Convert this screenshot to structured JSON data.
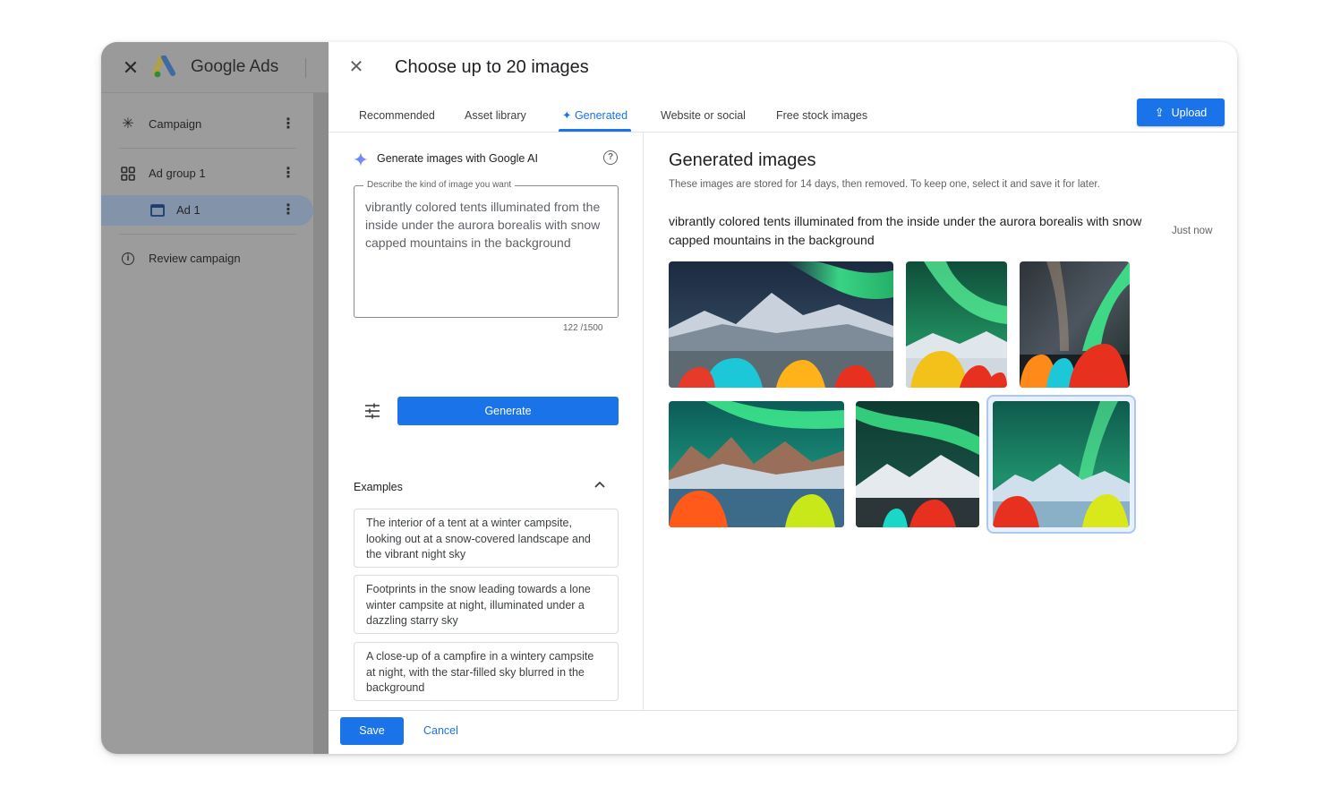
{
  "sidebar": {
    "brand": "Google Ads",
    "items": [
      {
        "label": "Campaign",
        "icon": "asterisk-icon"
      },
      {
        "label": "Ad group 1",
        "icon": "grid-icon"
      },
      {
        "label": "Ad 1",
        "icon": "ad-icon"
      },
      {
        "label": "Review campaign",
        "icon": "info-icon"
      }
    ]
  },
  "dialog": {
    "title": "Choose up to 20 images",
    "tabs": [
      {
        "label": "Recommended"
      },
      {
        "label": "Asset library"
      },
      {
        "label": "✦ Generated",
        "active": true
      },
      {
        "label": "Website or social"
      },
      {
        "label": "Free stock images"
      }
    ],
    "upload_label": "Upload"
  },
  "generator": {
    "heading": "Generate images with Google AI",
    "prompt_label": "Describe the kind of image you want",
    "prompt_value": "vibrantly colored tents illuminated from the inside under the aurora borealis with snow capped mountains in the background",
    "char_count": "122 /1500",
    "generate_label": "Generate",
    "examples_heading": "Examples",
    "examples": [
      "The interior of a tent at a winter campsite, looking out at a snow-covered landscape and the vibrant night sky",
      "Footprints in the snow leading towards a lone winter campsite at night, illuminated under a dazzling starry sky",
      "A close-up of a campfire in a wintery campsite at night, with the star-filled sky blurred in the background"
    ]
  },
  "results": {
    "title": "Generated images",
    "subtitle": "These images are stored for 14 days, then removed. To keep one, select it and save it for later.",
    "prompt": "vibrantly colored tents illuminated from the inside under the aurora borealis with snow capped mountains in the background",
    "time": "Just now"
  },
  "footer": {
    "save_label": "Save",
    "cancel_label": "Cancel"
  },
  "colors": {
    "accent": "#1a73e8",
    "sidebar_dim": "#9c9c9c",
    "sidebar_active": "#8393a9"
  }
}
